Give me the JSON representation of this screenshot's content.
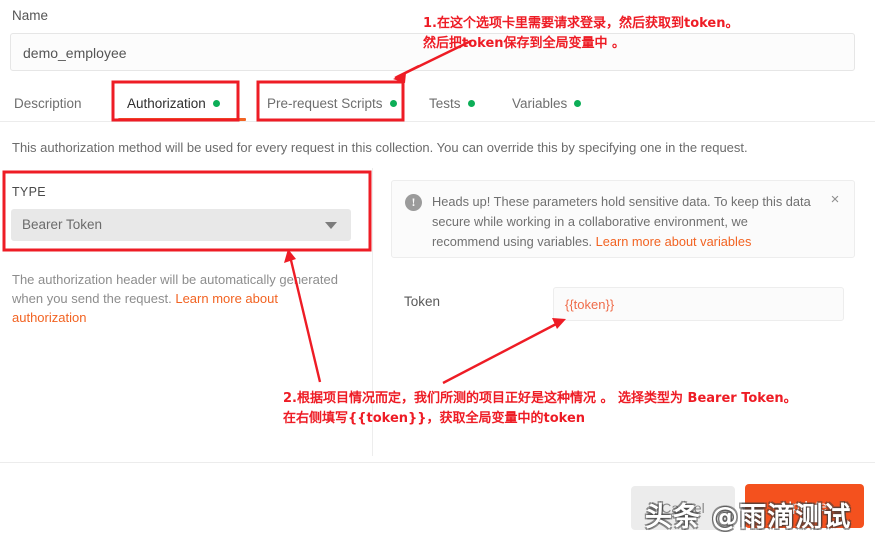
{
  "form": {
    "name_label": "Name",
    "name_value": "demo_employee"
  },
  "tabs": [
    {
      "label": "Description",
      "has_dot": false,
      "active": false
    },
    {
      "label": "Authorization",
      "has_dot": true,
      "active": true
    },
    {
      "label": "Pre-request Scripts",
      "has_dot": true,
      "active": false
    },
    {
      "label": "Tests",
      "has_dot": true,
      "active": false
    },
    {
      "label": "Variables",
      "has_dot": true,
      "active": false
    }
  ],
  "collection_note": "This authorization method will be used for every request in this collection. You can override this by specifying one in the request.",
  "auth_panel": {
    "type_label": "TYPE",
    "type_value": "Bearer Token",
    "help_text": "The authorization header will be automatically generated when you send the request. ",
    "help_link": "Learn more about authorization"
  },
  "heads_up": {
    "icon": "exclamation-circle-icon",
    "text": "Heads up! These parameters hold sensitive data. To keep this data secure while working in a collaborative environment, we recommend using variables. ",
    "link": "Learn more about variables",
    "close_label": "×"
  },
  "token_row": {
    "label": "Token",
    "value": "{{token}}"
  },
  "footer": {
    "cancel_label": "Cancel",
    "update_label": "Update"
  },
  "annotations": [
    {
      "id": "1",
      "line1": "1.在这个选项卡里需要请求登录，然后获取到token。",
      "line2": "然后把token保存到全局变量中 。"
    },
    {
      "id": "2",
      "line1": "2.根据项目情况而定，我们所测的项目正好是这种情况 。 选择类型为 Bearer Token。",
      "line2": "在右侧填写{{token}}，获取全局变量中的token"
    }
  ],
  "watermark": "头条 @雨滴测试",
  "colors": {
    "accent_orange": "#f26322",
    "update_button": "#f4511e",
    "annotation_red": "#ee1c25",
    "status_dot_green": "#0cae57"
  }
}
